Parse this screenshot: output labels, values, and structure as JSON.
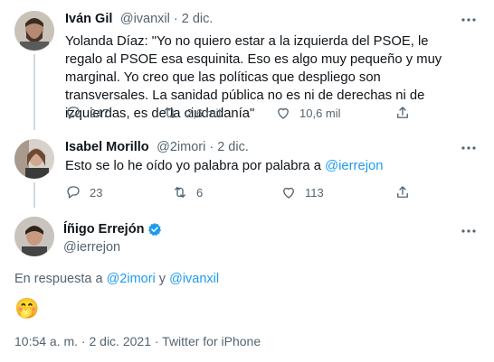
{
  "tweet1": {
    "name": "Iván Gil",
    "handle_time": "@ivanxil · 2 dic.",
    "text": "Yolanda Díaz: \"Yo no quiero estar a la izquierda del PSOE, le regalo al PSOE esa esquinita. Eso es algo muy pequeño y muy marginal. Yo creo que las políticas que despliego son transversales. La sanidad pública no es ni de derechas ni de izquierdas, es de la ciudadanía\"",
    "replies": "247",
    "retweets": "2,6 mil",
    "likes": "10,6 mil"
  },
  "tweet2": {
    "name": "Isabel Morillo",
    "handle_time": "@2imori · 2 dic.",
    "text_prefix": "Esto se lo he oído yo palabra por palabra a ",
    "mention": "@ierrejon",
    "replies": "23",
    "retweets": "6",
    "likes": "113"
  },
  "main_tweet": {
    "name": "Íñigo Errejón",
    "handle": "@ierrejon",
    "reply_prefix": "En respuesta a ",
    "reply_mention_1": "@2imori",
    "reply_conj": " y ",
    "reply_mention_2": "@ivanxil",
    "emoji": "🤭",
    "timestamp": "10:54 a. m. · 2 dic. 2021 · Twitter for iPhone"
  },
  "icons": [
    "more-icon",
    "reply-icon",
    "retweet-icon",
    "like-icon",
    "share-icon",
    "verified-icon"
  ],
  "colors": {
    "link": "#1d9bf0",
    "muted": "#536471",
    "text": "#0f1419",
    "verified": "#1d9bf0"
  }
}
